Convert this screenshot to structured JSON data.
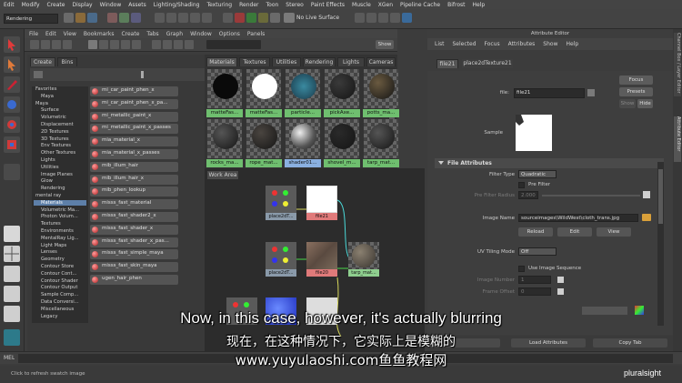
{
  "menubar": [
    "Edit",
    "Modify",
    "Create",
    "Display",
    "Window",
    "Assets",
    "Lighting/Shading",
    "Texturing",
    "Render",
    "Toon",
    "Stereo",
    "Paint Effects",
    "Muscle",
    "XGen",
    "Pipeline Cache",
    "Bifrost",
    "Help"
  ],
  "statusline": {
    "mode": "Rendering",
    "live_surface": "No Live Surface"
  },
  "hypershade": {
    "menu": [
      "File",
      "Edit",
      "View",
      "Bookmarks",
      "Create",
      "Tabs",
      "Graph",
      "Window",
      "Options",
      "Panels"
    ],
    "show_label": "Show",
    "create_tabs": [
      "Create",
      "Bins"
    ],
    "tree": [
      "Favorites",
      "Maya",
      "Maya",
      "Surface",
      "Volumetric",
      "Displacement",
      "2D Textures",
      "3D Textures",
      "Env Textures",
      "Other Textures",
      "Lights",
      "Utilities",
      "Image Planes",
      "Glow",
      "Rendering",
      "mental ray",
      "Materials",
      "Volumetric Ma...",
      "Photon Volum...",
      "Textures",
      "Environments",
      "MentalRay Lig...",
      "Light Maps",
      "Lenses",
      "Geometry",
      "Contour Store",
      "Contour Cont...",
      "Contour Shader",
      "Contour Output",
      "Sample Comp...",
      "Data Conversi...",
      "Miscellaneous",
      "Legacy"
    ],
    "tree_selected": 16,
    "nodes": [
      "mi_car_paint_phen_x",
      "mi_car_paint_phen_x_pa...",
      "mi_metallic_paint_x",
      "mi_metallic_paint_x_passes",
      "mia_material_x",
      "mia_material_x_passes",
      "mib_illum_hair",
      "mib_illum_hair_x",
      "mib_phen_lookup",
      "misss_fast_material",
      "misss_fast_shader2_x",
      "misss_fast_shader_x",
      "misss_fast_shader_x_pas...",
      "misss_fast_simple_maya",
      "misss_fast_skin_maya",
      "ugen_hair_phen"
    ],
    "mat_tabs": [
      "Materials",
      "Textures",
      "Utilities",
      "Rendering",
      "Lights",
      "Cameras"
    ],
    "swatches_row1": [
      "matteFas...",
      "matteFas...",
      "particle...",
      "pickAxe...",
      "potts_ma..."
    ],
    "swatches_row2": [
      "rocks_ma...",
      "rope_mat...",
      "shader01...",
      "shovel_m...",
      "tarp_mat..."
    ],
    "work_area_tab": "Work Area",
    "graph_nodes": [
      "place2dT...",
      "file21",
      "place2dT...",
      "file20",
      "tarp_mat...",
      "place2dT..."
    ]
  },
  "attribute_editor": {
    "title": "Attribute Editor",
    "menu": [
      "List",
      "Selected",
      "Focus",
      "Attributes",
      "Show",
      "Help"
    ],
    "tabs": [
      "file21",
      "place2dTexture21"
    ],
    "file_label": "file:",
    "file_value": "file21",
    "buttons": {
      "focus": "Focus",
      "presets": "Presets",
      "show": "Show",
      "hide": "Hide"
    },
    "sample_label": "Sample",
    "section": "File Attributes",
    "filter_type_label": "Filter Type",
    "filter_type_value": "Quadratic",
    "pre_filter_label": "Pre Filter",
    "pre_filter_radius_label": "Pre Filter Radius",
    "pre_filter_radius_value": "2.000",
    "image_name_label": "Image Name",
    "image_name_value": "sourceimages\\WildWest\\cloth_trans.jpg",
    "reload": "Reload",
    "edit": "Edit",
    "view": "View",
    "uv_tiling_label": "UV Tiling Mode",
    "uv_tiling_value": "Off",
    "use_image_seq_label": "Use Image Sequence",
    "image_number_label": "Image Number",
    "image_number_value": "1",
    "frame_offset_label": "Frame Offset",
    "frame_offset_value": "0",
    "bottom_buttons": [
      "Load Attributes",
      "Copy Tab"
    ]
  },
  "side_tabs": [
    "Channel Box / Layer Editor",
    "Attribute Editor"
  ],
  "mel_label": "MEL",
  "help_line": "Click to refresh swatch image",
  "subtitles": {
    "english": "Now, in this case, however, it's actually blurring",
    "chinese": "现在，在这种情况下，它实际上是模糊的",
    "watermark": "www.yuyulaoshi.com鱼鱼教程网"
  },
  "brand": "pluralsight"
}
